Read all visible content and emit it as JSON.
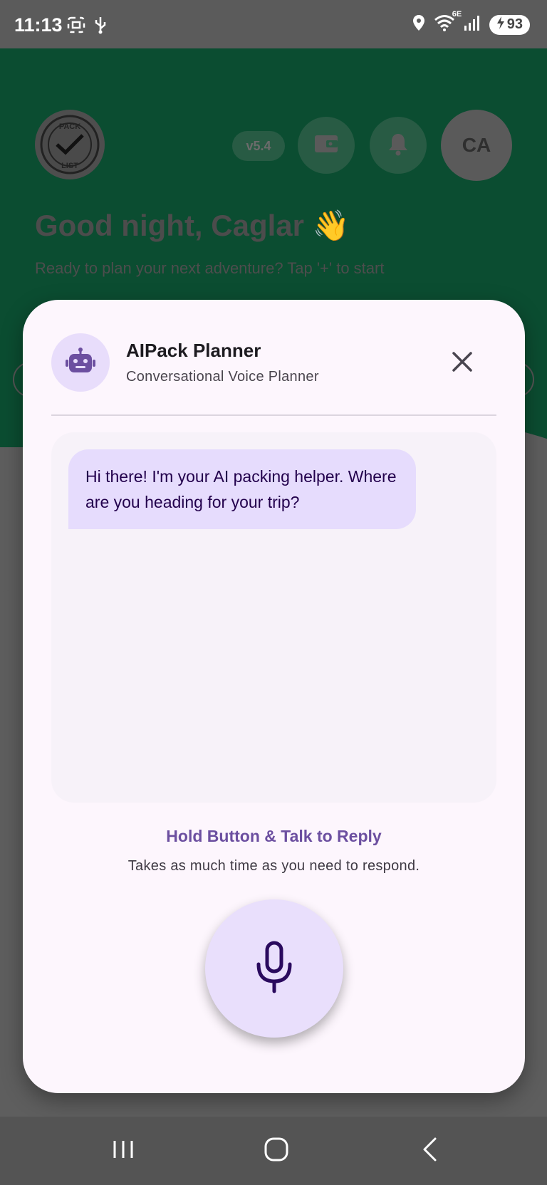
{
  "status_bar": {
    "time": "11:13",
    "network": "6E",
    "battery": "93",
    "icons": [
      "screenshot-icon",
      "usb-icon",
      "location-icon",
      "wifi-icon",
      "signal-icon",
      "battery-charging-icon"
    ]
  },
  "background_app": {
    "logo_text_top": "PACK",
    "logo_text_bottom": "LIST",
    "version": "v5.4",
    "avatar_initials": "CA",
    "greeting": "Good night, Caglar 👋",
    "subgreeting": "Ready to plan your next adventure? Tap '+' to start",
    "colors": {
      "header_bg": "#0b4d31",
      "scrim": "#5e5e5e"
    }
  },
  "dialog": {
    "title": "AIPack Planner",
    "subtitle": "Conversational Voice Planner",
    "messages": [
      {
        "sender": "bot",
        "text": "Hi there! I'm your AI packing helper. Where are you heading for your trip?"
      }
    ],
    "hint_title": "Hold Button & Talk to Reply",
    "hint_subtitle": "Takes as much time as you need to respond.",
    "colors": {
      "surface": "#fdf6fd",
      "bubble": "#e6dcfd",
      "accent": "#6c4fa0",
      "mic_bg": "#e9dffc"
    }
  }
}
